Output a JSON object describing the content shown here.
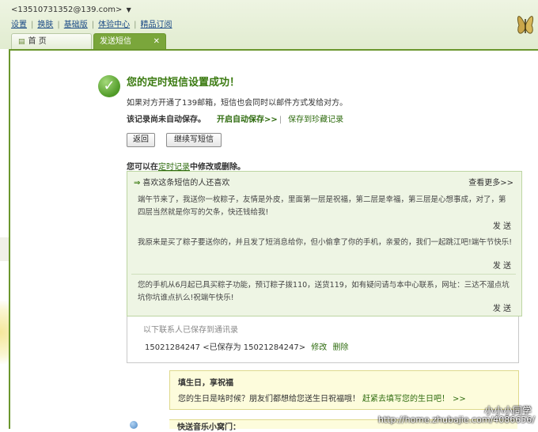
{
  "header": {
    "account": "<13510731352@139.com>",
    "menu": [
      "设置",
      "换肤",
      "基础版",
      "体验中心",
      "精品订阅"
    ],
    "tabs": {
      "home": "首 页",
      "sms": "发送短信"
    }
  },
  "result": {
    "title": "您的定时短信设置成功！",
    "subtitle": "如果对方开通了139邮箱，短信也会同时以邮件方式发给对方。",
    "not_saved": "该记录尚未自动保存。",
    "auto_save": "开启自动保存>>",
    "save_favorites": "保存到珍藏记录",
    "buttons": {
      "back": "返回",
      "continue": "继续写短信"
    },
    "modify_prefix": "您可以在",
    "modify_link": "定时记录",
    "modify_suffix": "中修改或删除。"
  },
  "recommend": {
    "heading": "喜欢这条短信的人还喜欢",
    "more": "查看更多>>",
    "send_label": "发 送",
    "items": [
      "端午节来了，我送你一枚粽子，友情是外皮，里面第一层是祝福，第二层是幸福，第三层是心想事成，对了，第四层当然就是你写的欠条，快还钱给我!",
      "我原来是买了粽子要送你的，并且发了短消息给你，但小偷拿了你的手机，亲爱的，我们一起跳江吧!端午节快乐!",
      "您的手机从6月起已具买粽子功能，预订粽子拨110，送货119，如有疑问请与本中心联系，网址：三达不溜点坑坑你坑谁点扒么!祝端午快乐!"
    ]
  },
  "contacts": {
    "label": "以下联系人已保存到通讯录",
    "number": "15021284247",
    "saved_as": "<已保存为 15021284247>",
    "modify": "修改",
    "delete": "删除"
  },
  "birthday": {
    "title": "填生日，享祝福",
    "text": "您的生日是啥时候？朋友们都想给您送生日祝福哦！",
    "link": "赶紧去填写您的生日吧！",
    "more": ">>"
  },
  "next_section": "快送音乐小窝门：",
  "watermark": {
    "name": "小小小同学",
    "url": "http://home.zhubajie.com/4086656/"
  },
  "colors": {
    "accent": "#7aa63b",
    "title_green": "#3a7a10",
    "link_green": "#2e6b0e",
    "panel_bg": "#eef5e4",
    "birthday_bg": "#fdfcdc"
  }
}
